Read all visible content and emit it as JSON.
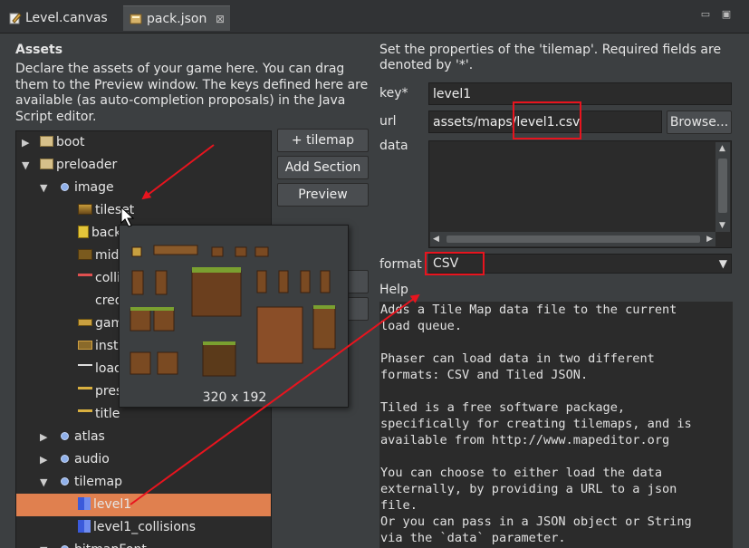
{
  "tabs": [
    {
      "label": "Level.canvas"
    },
    {
      "label": "pack.json",
      "close": "⊠"
    }
  ],
  "window_controls": {
    "minimize": "▭",
    "maximize": "▣"
  },
  "assets": {
    "title": "Assets",
    "description": "Declare the assets of your game here. You can drag them to the Preview window. The keys defined here are available (as auto-completion proposals) in the Java Script editor.",
    "tree": [
      {
        "label": "boot"
      },
      {
        "label": "preloader"
      },
      {
        "label": "image"
      },
      {
        "label": "tileset"
      },
      {
        "label": "back"
      },
      {
        "label": "mid"
      },
      {
        "label": "colli"
      },
      {
        "label": "cred"
      },
      {
        "label": "gam"
      },
      {
        "label": "instr"
      },
      {
        "label": "load"
      },
      {
        "label": "pres"
      },
      {
        "label": "title"
      },
      {
        "label": "atlas"
      },
      {
        "label": "audio"
      },
      {
        "label": "tilemap"
      },
      {
        "label": "level1"
      },
      {
        "label": "level1_collisions"
      },
      {
        "label": "bitmapFont"
      }
    ],
    "buttons": {
      "add_tilemap": "+ tilemap",
      "add_section": "Add Section",
      "preview": "Preview"
    },
    "preview_popup": {
      "dimensions": "320 x 192"
    }
  },
  "properties": {
    "intro": "Set the properties of the 'tilemap'. Required fields are denoted by '*'.",
    "key_label": "key*",
    "key_value": "level1",
    "url_label": "url",
    "url_value": "assets/maps/level1.csv",
    "browse_label": "Browse...",
    "data_label": "data",
    "data_value": "",
    "format_label": "format",
    "format_value": "CSV",
    "help_label": "Help",
    "help_text": "Adds a Tile Map data file to the current\nload queue.\n\nPhaser can load data in two different\nformats: CSV and Tiled JSON.\n\nTiled is a free software package,\nspecifically for creating tilemaps, and is\navailable from http://www.mapeditor.org\n\nYou can choose to either load the data\nexternally, by providing a URL to a json\nfile.\nOr you can pass in a JSON object or String\nvia the `data` parameter."
  },
  "colors": {
    "selection": "#e0804f",
    "annotation": "#e8141e"
  }
}
